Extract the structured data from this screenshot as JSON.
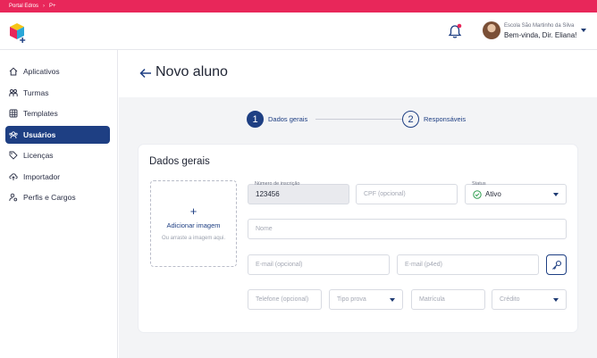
{
  "breadcrumb": {
    "portal": "Portal Edros",
    "current": "P+"
  },
  "header": {
    "school": "Escola São Martinho da Silva",
    "greeting": "Bem-vinda, Dir. Eliana!"
  },
  "sidebar": {
    "items": [
      {
        "label": "Aplicativos",
        "icon": "home-icon"
      },
      {
        "label": "Turmas",
        "icon": "users-icon"
      },
      {
        "label": "Templates",
        "icon": "grid-icon"
      },
      {
        "label": "Usuários",
        "icon": "user-group-icon",
        "active": true
      },
      {
        "label": "Licenças",
        "icon": "tag-icon"
      },
      {
        "label": "Importador",
        "icon": "cloud-upload-icon"
      },
      {
        "label": "Perfis e Cargos",
        "icon": "user-settings-icon"
      }
    ]
  },
  "page": {
    "title": "Novo aluno"
  },
  "stepper": {
    "steps": [
      {
        "number": "1",
        "label": "Dados gerais"
      },
      {
        "number": "2",
        "label": "Responsáveis"
      }
    ]
  },
  "form": {
    "section_title": "Dados gerais",
    "image": {
      "plus": "+",
      "label": "Adicionar imagem",
      "hint": "Ou arraste a imagem aqui."
    },
    "registration": {
      "label": "Número de inscrição",
      "value": "123456"
    },
    "cpf": {
      "placeholder": "CPF (opcional)"
    },
    "status": {
      "label": "Status",
      "value": "Ativo"
    },
    "name": {
      "placeholder": "Nome"
    },
    "email_optional": {
      "placeholder": "E-mail (opcional)"
    },
    "email_p4ed": {
      "placeholder": "E-mail (p4ed)"
    },
    "phone": {
      "placeholder": "Telefone (opcional)"
    },
    "test_type": {
      "placeholder": "Tipo prova"
    },
    "enrollment": {
      "placeholder": "Matrícula"
    },
    "credit": {
      "placeholder": "Crédito"
    }
  },
  "colors": {
    "topbar": "#e8275a",
    "primary": "#1e3f83",
    "status_green": "#2e9e4f"
  }
}
